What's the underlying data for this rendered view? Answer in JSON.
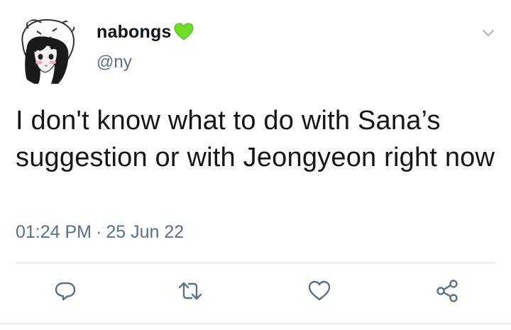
{
  "tweet": {
    "display_name": "nabongs",
    "name_emoji": "green-heart-icon",
    "handle": "@ny",
    "text": "I don't know what to do with Sana’s suggestion or with Jeongyeon right now",
    "time": "01:24 PM",
    "separator": "·",
    "date": "25 Jun 22"
  },
  "actions": [
    "reply-icon",
    "retweet-icon",
    "like-icon",
    "share-icon"
  ],
  "colors": {
    "text": "#14171a",
    "secondary": "#5b7083",
    "heart": "#6fdc2a",
    "divider": "#d6dde3"
  }
}
